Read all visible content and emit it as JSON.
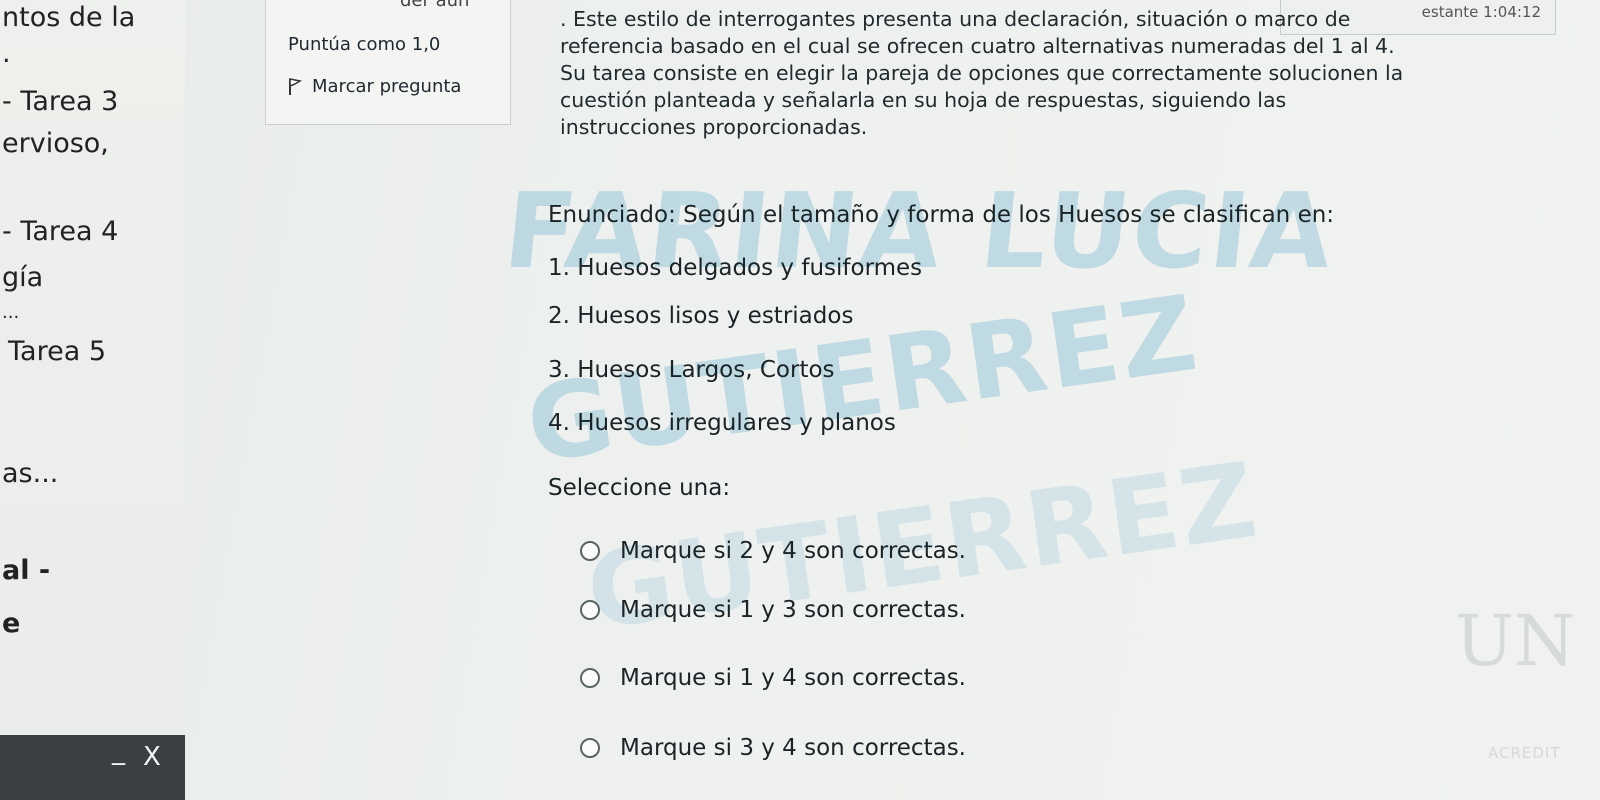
{
  "sidebar": {
    "items": [
      "ntos de la",
      ".",
      "- Tarea 3",
      "ervioso,",
      "- Tarea 4",
      "gía",
      "...",
      "Tarea 5",
      "as...",
      "al -",
      "e"
    ],
    "minimize": "_",
    "close": "X"
  },
  "question_info": {
    "status_partial": "der aún",
    "score": "Puntúa como 1,0",
    "flag_label": "Marcar pregunta"
  },
  "timer": {
    "label": "estante 1:04:12"
  },
  "question": {
    "instructions": ". Este estilo de interrogantes presenta una declaración, situación o marco de referencia basado en el cual se ofrecen cuatro alternativas numeradas del 1 al 4. Su tarea consiste en elegir la pareja de opciones que correctamente solucionen la cuestión planteada y señalarla en su hoja de respuestas, siguiendo las instrucciones proporcionadas.",
    "statement": "Enunciado: Según el tamaño y forma de los Huesos se clasifican en:",
    "items": [
      "1. Huesos delgados y fusiformes",
      "2. Huesos lisos y estriados",
      "3. Huesos Largos, Cortos",
      "4. Huesos irregulares y planos"
    ],
    "prompt": "Seleccione una:",
    "answers": [
      "Marque si 2 y 4 son correctas.",
      "Marque si 1 y 3 son correctas.",
      "Marque si 1 y 4 son correctas.",
      "Marque si 3 y 4 son correctas."
    ]
  },
  "watermark": {
    "lines": [
      "FARINA LUCIA",
      "GUTIERREZ",
      "GUTIERREZ"
    ]
  },
  "logo": {
    "letter": "UN",
    "text": "ACREDIT"
  },
  "colors": {
    "watermark": "#489ec4",
    "sidebar_bottom": "#3b3f41",
    "background": "#eef1ef"
  }
}
